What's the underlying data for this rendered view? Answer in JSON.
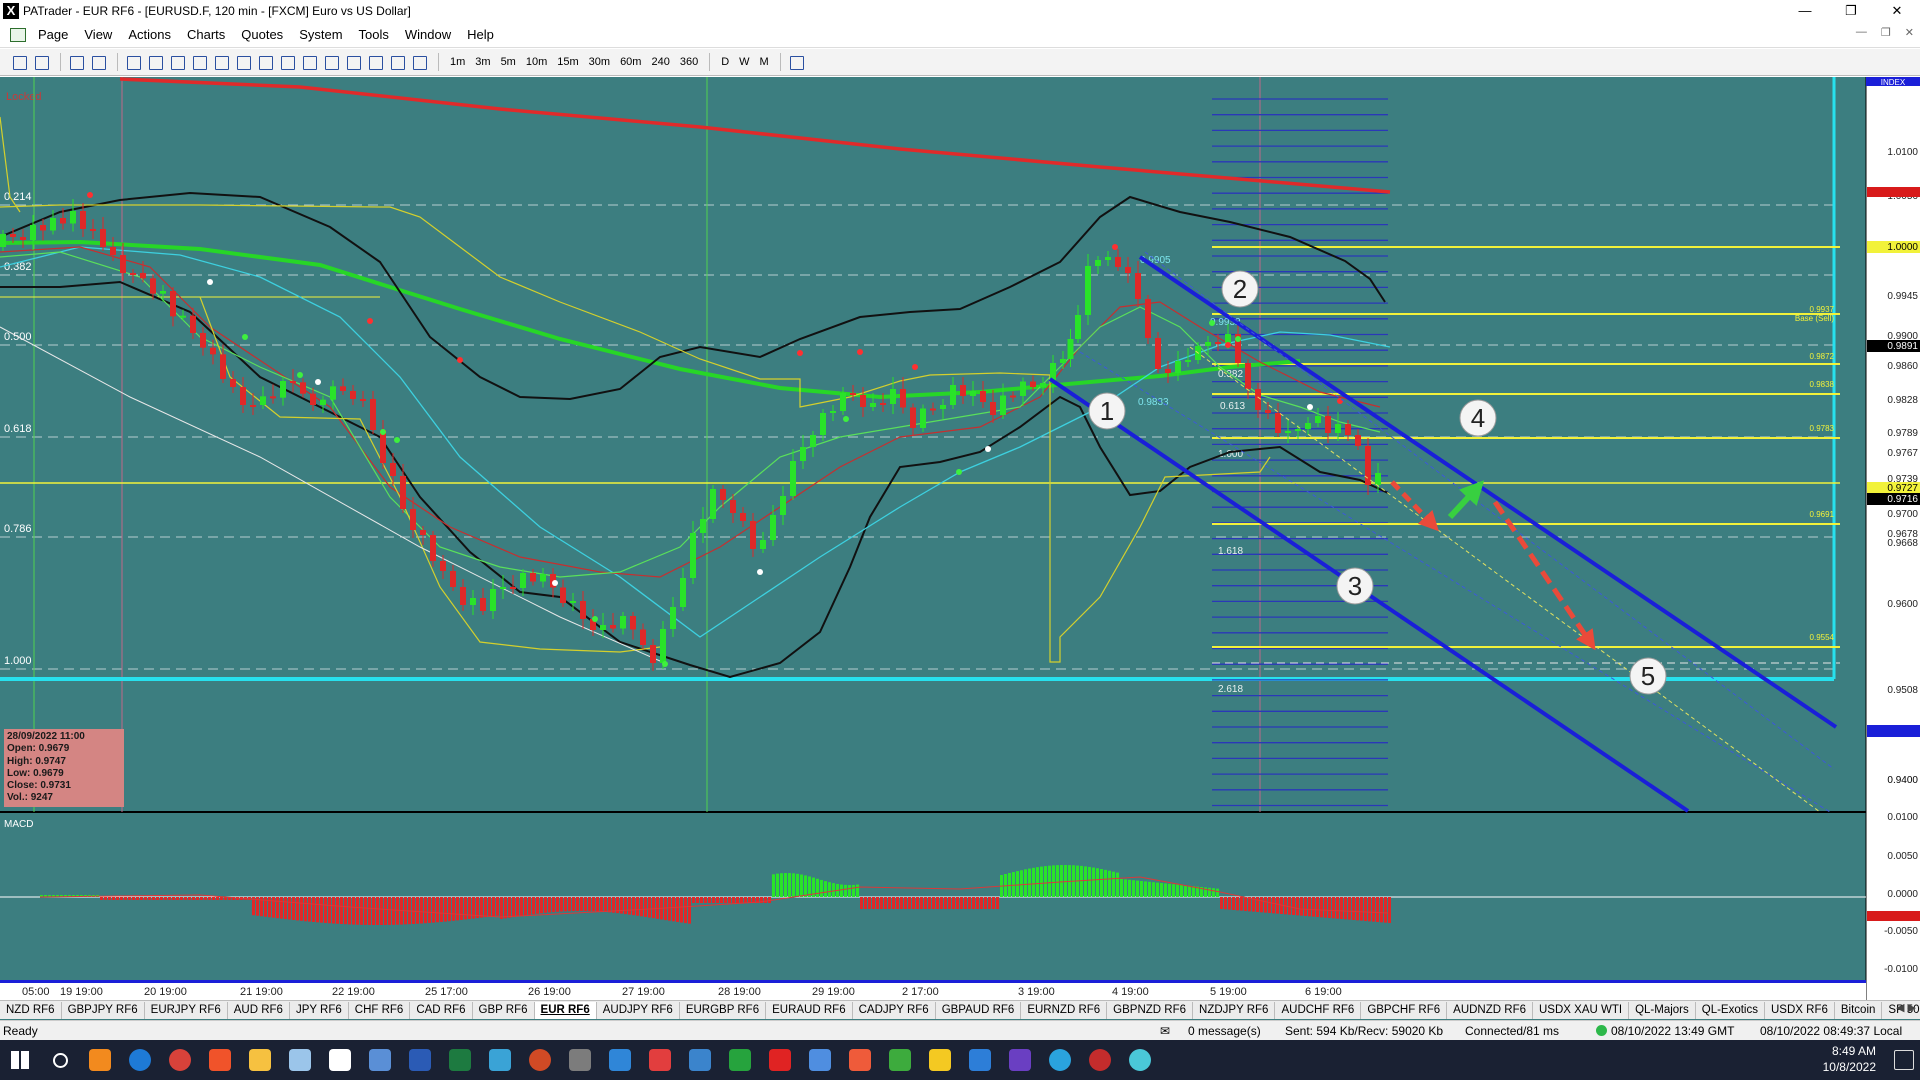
{
  "window": {
    "title": "PATrader - EUR RF6 - [EURUSD.F, 120 min - [FXCM] Euro vs US Dollar]",
    "app_icon": "X",
    "controls": [
      "minimize-icon",
      "restore-icon",
      "close-icon"
    ]
  },
  "menu": {
    "items": [
      "Page",
      "View",
      "Actions",
      "Charts",
      "Quotes",
      "System",
      "Tools",
      "Window",
      "Help"
    ]
  },
  "toolbar": {
    "timeframes": [
      "1m",
      "3m",
      "5m",
      "10m",
      "15m",
      "30m",
      "60m",
      "240",
      "360",
      "D",
      "W",
      "M"
    ]
  },
  "chart": {
    "locked_label": "Locked",
    "index_label": "INDEX",
    "macd_label": "MACD",
    "fib_left_labels": [
      "0.214",
      "0.382",
      "0.500",
      "0.618",
      "0.786",
      "1.000"
    ],
    "price_axis": [
      "1.0100",
      "1.0056",
      "1.0000",
      "0.9945",
      "0.9900",
      "0.9891",
      "0.9860",
      "0.9828",
      "0.9789",
      "0.9767",
      "0.9739",
      "0.9727",
      "0.9716",
      "0.9700",
      "0.9678",
      "0.9668",
      "0.9600",
      "0.9508",
      "0.9400"
    ],
    "macd_axis": [
      "0.0100",
      "0.0050",
      "0.0000",
      "-0.0050",
      "-0.0100"
    ],
    "time_labels": [
      "05:00",
      "19 19:00",
      "20 19:00",
      "21 19:00",
      "22 19:00",
      "25 17:00",
      "26 19:00",
      "27 19:00",
      "28 19:00",
      "29 19:00",
      "2 17:00",
      "3 19:00",
      "4 19:00",
      "5 19:00",
      "6 19:00"
    ],
    "wave_labels": [
      "1",
      "2",
      "3",
      "4",
      "5"
    ],
    "fib_inner_labels": [
      "0.9905",
      "0.9932",
      "0.382",
      "0.9833",
      "0.613",
      "1.000",
      "1.618",
      "2.618"
    ],
    "right_fib_labels": [
      "0.9937",
      "Base (Sell)",
      "0.9872",
      "0.9838",
      "0.9783",
      "0.9691",
      "0.9554"
    ],
    "colors": {
      "background": "#3c7e80",
      "bull_candle": "#29e329",
      "bear_candle": "#e02828",
      "red_ma": "#e02a2a",
      "green_ma": "#27d627",
      "channel": "#1a1fd8",
      "cyan_line": "#27e1ee",
      "fib_yellow": "#f2f23a"
    }
  },
  "ohlc_box": {
    "date": "28/09/2022 11:00",
    "open": "Open: 0.9679",
    "high": "High: 0.9747",
    "low": "Low: 0.9679",
    "close": "Close: 0.9731",
    "vol": "Vol.: 9247"
  },
  "symbol_tabs": [
    "NZD RF6",
    "GBPJPY RF6",
    "EURJPY RF6",
    "AUD RF6",
    "JPY RF6",
    "CHF RF6",
    "CAD RF6",
    "GBP RF6",
    "EUR RF6",
    "AUDJPY RF6",
    "EURGBP RF6",
    "EURAUD RF6",
    "CADJPY RF6",
    "GBPAUD RF6",
    "EURNZD RF6",
    "GBPNZD RF6",
    "NZDJPY RF6",
    "AUDCHF RF6",
    "GBPCHF RF6",
    "AUDNZD RF6",
    "USDX XAU WTI",
    "QL-Majors",
    "QL-Exotics",
    "USDX RF6",
    "Bitcoin",
    "SP 500"
  ],
  "active_tab": "EUR RF6",
  "status": {
    "ready": "Ready",
    "messages": "0 message(s)",
    "traffic": "Sent: 594 Kb/Recv: 59020 Kb",
    "connected": "Connected/81 ms",
    "gmt": "08/10/2022 13:49 GMT",
    "local": "08/10/2022 08:49:37 Local"
  },
  "taskbar": {
    "time": "8:49 AM",
    "date": "10/8/2022"
  }
}
